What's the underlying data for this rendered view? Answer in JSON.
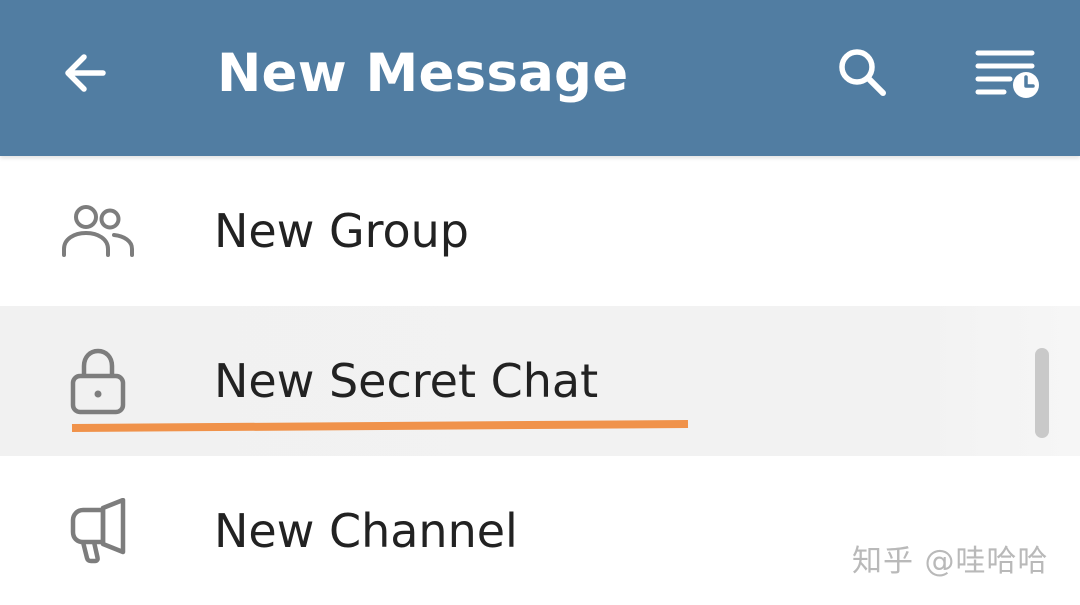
{
  "header": {
    "title": "New Message",
    "back_icon": "arrow-left-icon",
    "search_icon": "search-icon",
    "sort_icon": "sort-by-time-icon",
    "background_color": "#517da2"
  },
  "menu": {
    "items": [
      {
        "label": "New Group",
        "icon": "group-icon"
      },
      {
        "label": "New Secret Chat",
        "icon": "lock-icon"
      },
      {
        "label": "New Channel",
        "icon": "megaphone-icon"
      }
    ]
  },
  "annotation": {
    "underline_color": "#f0924a"
  },
  "watermark": {
    "text": "知乎 @哇哈哈"
  }
}
